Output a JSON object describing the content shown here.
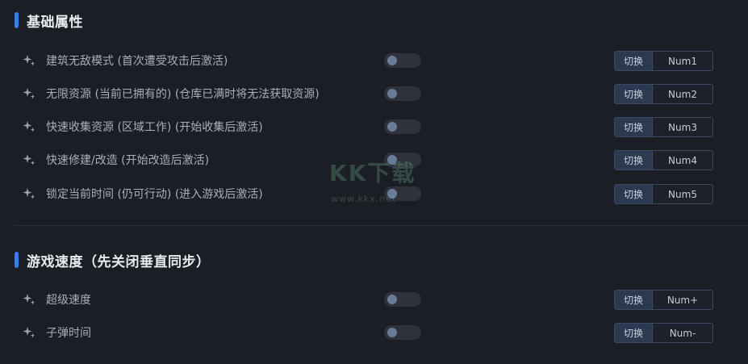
{
  "sections": [
    {
      "title": "基础属性",
      "rows": [
        {
          "label": "建筑无敌模式 (首次遭受攻击后激活)",
          "switch_label": "切换",
          "key": "Num1",
          "enabled": false
        },
        {
          "label": "无限资源 (当前已拥有的) (仓库已满时将无法获取资源)",
          "switch_label": "切换",
          "key": "Num2",
          "enabled": false
        },
        {
          "label": "快速收集资源 (区域工作) (开始收集后激活)",
          "switch_label": "切换",
          "key": "Num3",
          "enabled": false
        },
        {
          "label": "快速修建/改造 (开始改造后激活)",
          "switch_label": "切换",
          "key": "Num4",
          "enabled": false
        },
        {
          "label": "锁定当前时间 (仍可行动) (进入游戏后激活)",
          "switch_label": "切换",
          "key": "Num5",
          "enabled": false
        }
      ]
    },
    {
      "title": "游戏速度（先关闭垂直同步）",
      "rows": [
        {
          "label": "超级速度",
          "switch_label": "切换",
          "key": "Num+",
          "enabled": false
        },
        {
          "label": "子弹时间",
          "switch_label": "切换",
          "key": "Num-",
          "enabled": false
        }
      ]
    }
  ],
  "watermark": {
    "main": "KK下载",
    "sub": "www.kkx.net"
  },
  "colors": {
    "background": "#1b1e24",
    "accent": "#3f7de6",
    "toggle_off": "#2e323a",
    "knob": "#6a7b96",
    "hotkey_border": "#3a4a62"
  },
  "icons": {
    "row_icon": "sparkle-icon"
  }
}
